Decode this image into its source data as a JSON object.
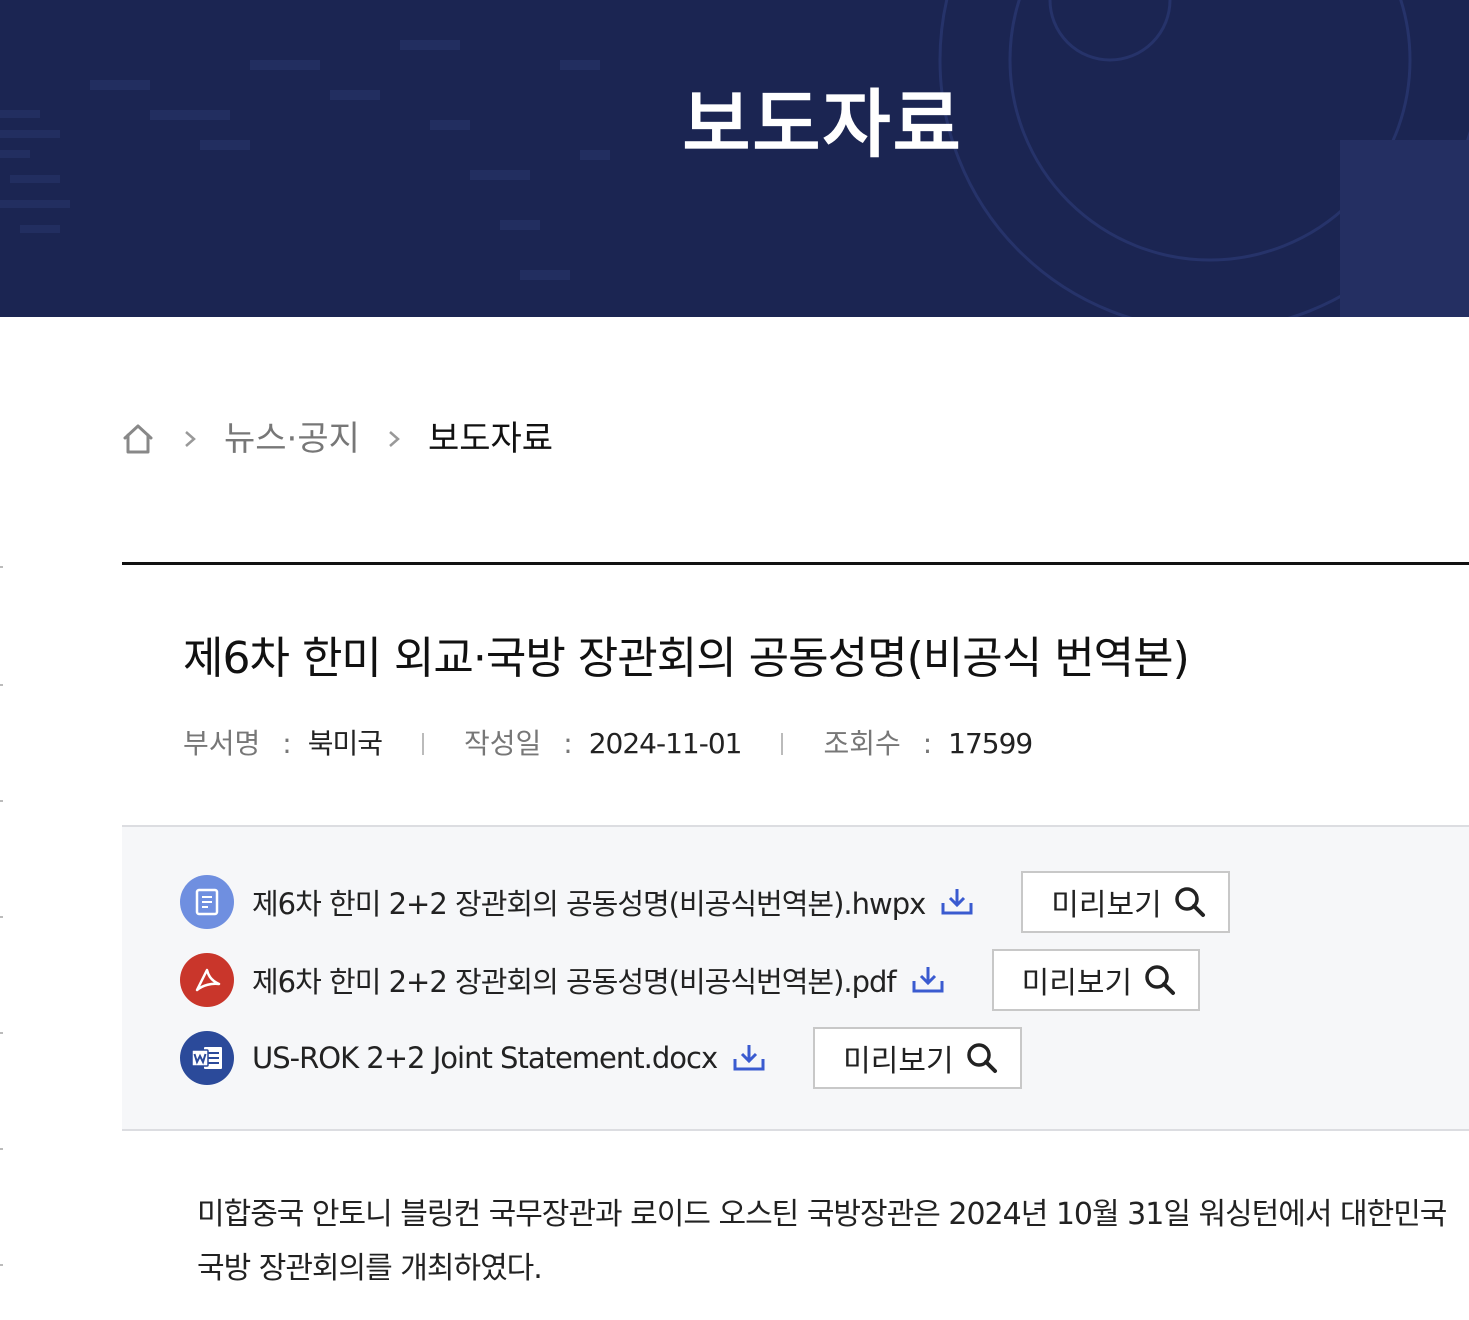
{
  "hero": {
    "title": "보도자료"
  },
  "breadcrumb": {
    "home_icon": "home-icon",
    "items": [
      "뉴스·공지",
      "보도자료"
    ]
  },
  "article": {
    "title": "제6차 한미 외교·국방 장관회의 공동성명(비공식 번역본)",
    "meta": {
      "department_label": "부서명",
      "department_value": "북미국",
      "date_label": "작성일",
      "date_value": "2024-11-01",
      "views_label": "조회수",
      "views_value": "17599"
    },
    "attachments": [
      {
        "name": "제6차 한미 2+2 장관회의 공동성명(비공식번역본).hwpx",
        "type": "hwpx",
        "icon": "hwp-document-icon",
        "icon_color": "#6f8fe0",
        "preview_label": "미리보기"
      },
      {
        "name": "제6차 한미 2+2 장관회의 공동성명(비공식번역본).pdf",
        "type": "pdf",
        "icon": "pdf-icon",
        "icon_color": "#c9362b",
        "preview_label": "미리보기"
      },
      {
        "name": "US-ROK 2+2 Joint Statement.docx",
        "type": "docx",
        "icon": "word-icon",
        "icon_color": "#2b4a9a",
        "preview_label": "미리보기"
      }
    ],
    "body": {
      "line1": "미합중국 안토니 블링컨 국무장관과 로이드 오스틴 국방장관은 2024년 10월 31일 워싱턴에서 대한민국",
      "line2": "국방 장관회의를 개최하였다."
    }
  },
  "colors": {
    "hero_bg": "#1b2552",
    "download_icon": "#3a5bd0",
    "attachment_bg": "#f6f7f9"
  }
}
